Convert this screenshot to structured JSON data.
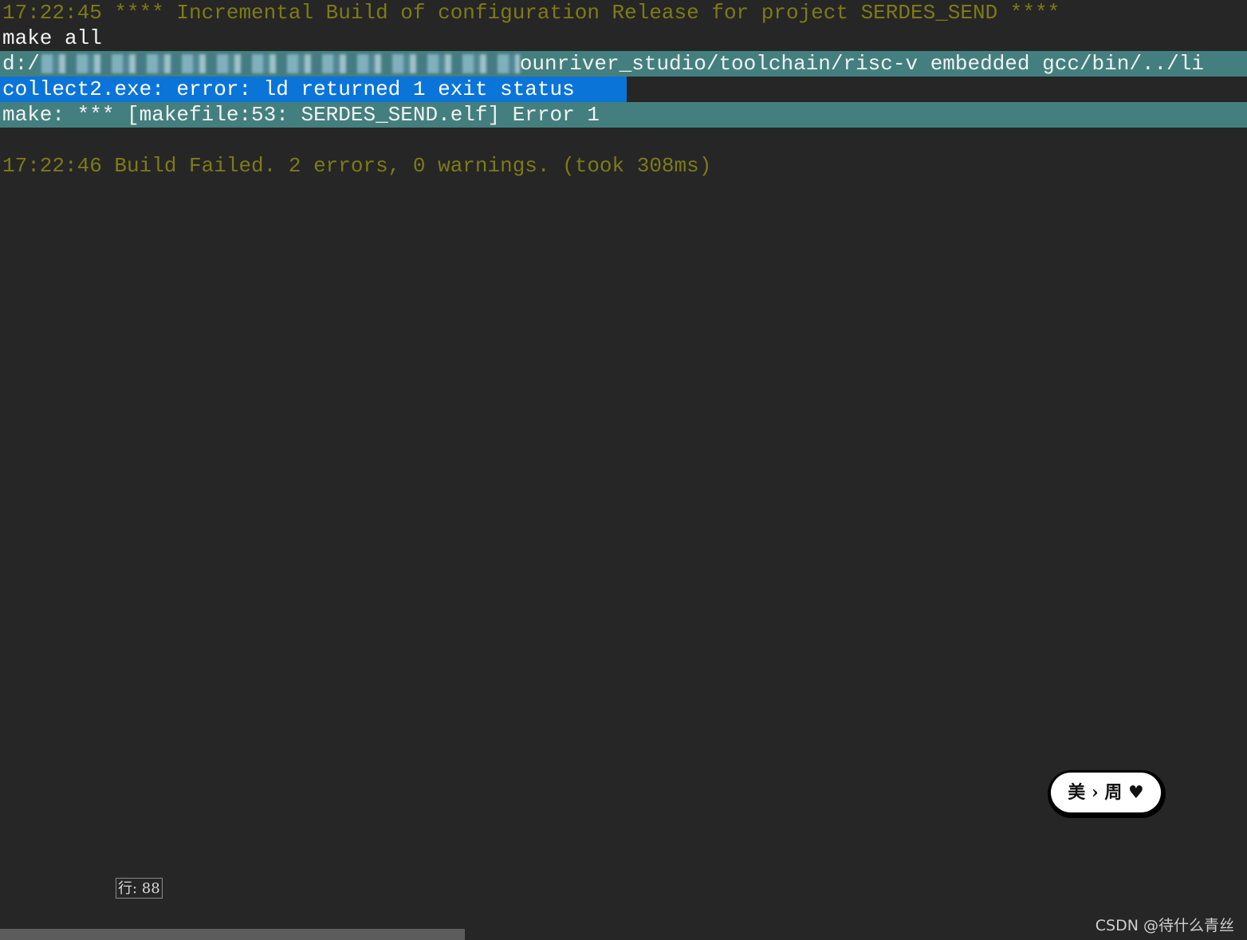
{
  "console": {
    "lines": {
      "build_start": "17:22:45 **** Incremental Build of configuration Release for project SERDES_SEND ****",
      "make_cmd": "make all",
      "path_prefix": "d:/",
      "path_suffix": "ounriver_studio/toolchain/risc-v embedded gcc/bin/../li",
      "collect_error": "collect2.exe: error: ld returned 1 exit status",
      "make_error": "make: *** [makefile:53: SERDES_SEND.elf] Error 1",
      "build_result": "17:22:46 Build Failed. 2 errors, 0 warnings. (took 308ms)"
    }
  },
  "status": {
    "line_indicator": "行: 88"
  },
  "badge": {
    "text": "美 › 周 ♥"
  },
  "watermark": {
    "text": "CSDN @待什么青丝"
  },
  "colors": {
    "background": "#262626",
    "timestamp_text": "#7d7b18",
    "error_line_highlight": "#447f7f",
    "selection": "#0b74d8"
  }
}
